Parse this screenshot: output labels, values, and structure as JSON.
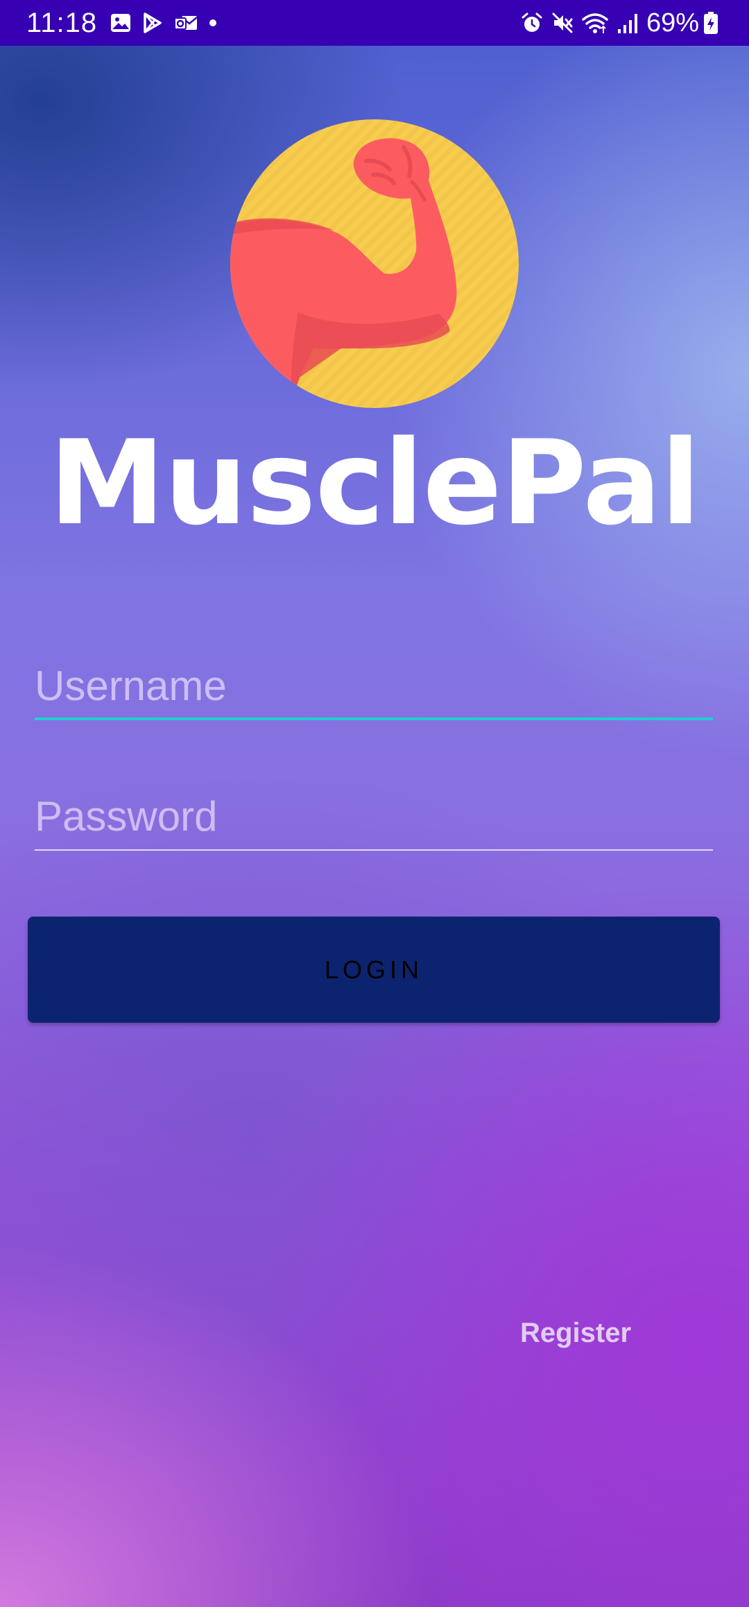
{
  "status_bar": {
    "time": "11:18",
    "battery_percent": "69%",
    "left_icons": [
      "gallery-icon",
      "play-store-icon",
      "outlook-icon",
      "notification-dot-icon"
    ],
    "right_icons": [
      "alarm-icon",
      "mute-icon",
      "wifi-icon",
      "signal-icon",
      "battery-charging-icon"
    ],
    "background_color": "#3700b3"
  },
  "app": {
    "name": "MusclePal",
    "logo": "flexed-arm-logo",
    "colors": {
      "logo_circle": "#f8cd4f",
      "logo_arm": "#fc5c60",
      "button": "#0c2470",
      "field_focus_line": "#1ed0d0"
    }
  },
  "login_form": {
    "username_placeholder": "Username",
    "username_value": "",
    "password_placeholder": "Password",
    "password_value": "",
    "login_button_label": "LOGIN",
    "register_link_label": "Register"
  }
}
